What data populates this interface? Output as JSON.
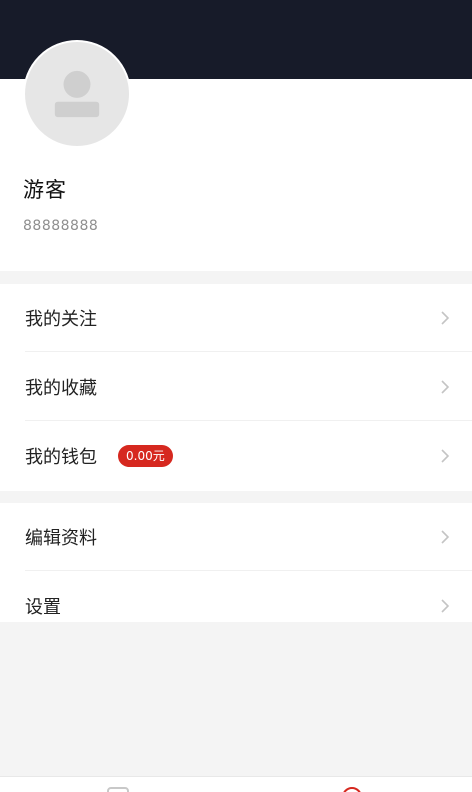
{
  "profile": {
    "username": "游客",
    "user_id": "88888888"
  },
  "menu": {
    "group_1": [
      {
        "label": "我的关注",
        "icon": "chevron-right-icon"
      },
      {
        "label": "我的收藏",
        "icon": "chevron-right-icon"
      },
      {
        "label": "我的钱包",
        "badge": "0.00元",
        "icon": "chevron-right-icon"
      }
    ],
    "group_2": [
      {
        "label": "编辑资料",
        "icon": "chevron-right-icon"
      },
      {
        "label": "设置",
        "icon": "chevron-right-icon"
      }
    ]
  },
  "colors": {
    "header": "#171b29",
    "accent": "#d6281f",
    "background": "#f4f4f4"
  },
  "tabbar": {
    "icons": [
      "home-icon",
      "me-icon"
    ],
    "active": "me-icon"
  }
}
